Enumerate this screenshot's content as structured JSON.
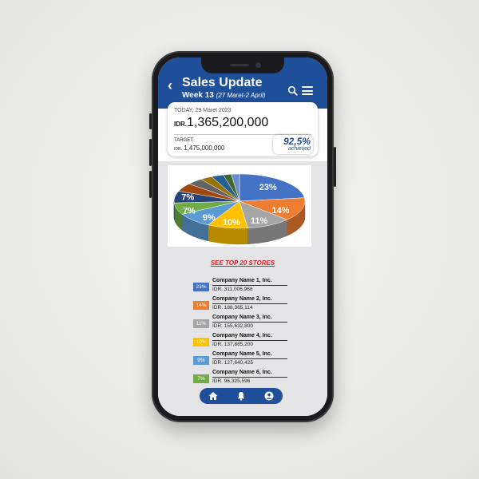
{
  "header": {
    "back_icon": "chevron-left-icon",
    "title": "Sales Update",
    "week": "Week 13",
    "date_range": "(27 Maret-2 April)",
    "search_icon": "search-icon",
    "menu_icon": "hamburger-menu-icon",
    "color": "#1f4f99"
  },
  "summary": {
    "date": "TODAY, 29 Maret 2023",
    "currency": "IDR.",
    "amount": "1,365,200,000",
    "target_label": "TARGET:",
    "target_currency": "IDR.",
    "target_value": "1,475,000,000",
    "percent": "92,5%",
    "achieved": "achieved"
  },
  "chart_data": {
    "type": "pie",
    "slices": [
      {
        "label": "23%",
        "value": 23,
        "color": "#4472c4"
      },
      {
        "label": "14%",
        "value": 14,
        "color": "#ed7d31"
      },
      {
        "label": "11%",
        "value": 11,
        "color": "#a5a5a5"
      },
      {
        "label": "10%",
        "value": 10,
        "color": "#ffc000"
      },
      {
        "label": "9%",
        "value": 9,
        "color": "#5b9bd5"
      },
      {
        "label": "7%",
        "value": 7,
        "color": "#70ad47"
      },
      {
        "label": "7%",
        "value": 7,
        "color": "#264478"
      },
      {
        "value": 5,
        "color": "#9e480e"
      },
      {
        "value": 4,
        "color": "#636363"
      },
      {
        "value": 3,
        "color": "#997300"
      },
      {
        "value": 3,
        "color": "#255e91"
      },
      {
        "value": 2,
        "color": "#43682b"
      },
      {
        "value": 2,
        "color": "#698ed0"
      }
    ]
  },
  "link_text": "SEE TOP 20 STORES",
  "stores": [
    {
      "pct": "23%",
      "name": "Company Name 1, Inc.",
      "value": "IDR. 311,006,968",
      "color": "#4472c4"
    },
    {
      "pct": "14%",
      "name": "Company Name 2, Inc.",
      "value": "IDR. 188,365,114",
      "color": "#ed7d31"
    },
    {
      "pct": "11%",
      "name": "Company Name 3, Inc.",
      "value": "IDR. 155,632,800",
      "color": "#a5a5a5"
    },
    {
      "pct": "10%",
      "name": "Company Name 4, Inc.",
      "value": "IDR. 137,885,200",
      "color": "#ffc000"
    },
    {
      "pct": "9%",
      "name": "Company Name 5, Inc.",
      "value": "IDR. 127,640,425",
      "color": "#5b9bd5"
    },
    {
      "pct": "7%",
      "name": "Company Name 6, Inc.",
      "value": "IDR. 96,325,596",
      "color": "#70ad47"
    }
  ],
  "nav": {
    "home_icon": "home-icon",
    "bell_icon": "bell-icon",
    "profile_icon": "user-icon"
  }
}
